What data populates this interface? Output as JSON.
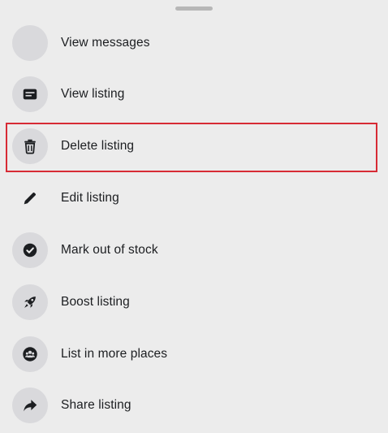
{
  "menu": {
    "items": [
      {
        "label": "View messages",
        "icon": "avatar-placeholder"
      },
      {
        "label": "View listing",
        "icon": "listing-card-icon"
      },
      {
        "label": "Delete listing",
        "icon": "trash-icon"
      },
      {
        "label": "Edit listing",
        "icon": "pencil-icon"
      },
      {
        "label": "Mark out of stock",
        "icon": "check-circle-icon"
      },
      {
        "label": "Boost listing",
        "icon": "rocket-icon"
      },
      {
        "label": "List in more places",
        "icon": "groups-icon"
      },
      {
        "label": "Share listing",
        "icon": "share-arrow-icon"
      }
    ]
  },
  "colors": {
    "background": "#ececec",
    "icon_circle": "#d9d9dc",
    "text": "#1c1e21",
    "highlight_border": "#d72b35"
  }
}
